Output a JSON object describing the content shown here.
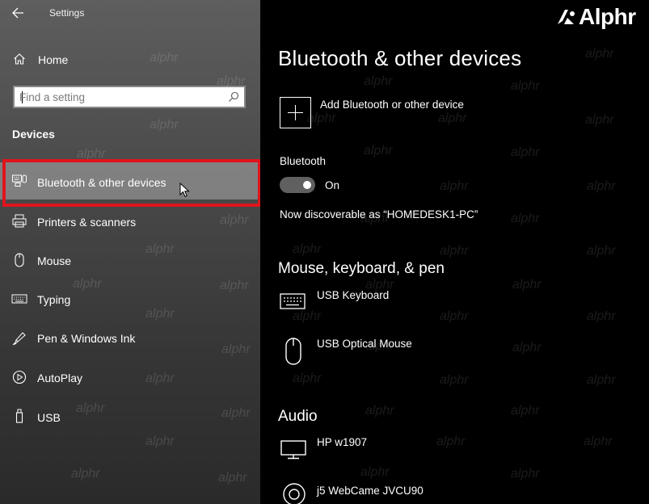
{
  "window": {
    "title": "Settings"
  },
  "sidebar": {
    "home_label": "Home",
    "search_placeholder": "Find a setting",
    "section_title": "Devices",
    "items": [
      {
        "label": "Bluetooth & other devices",
        "icon": "bluetooth-devices-icon",
        "selected": true
      },
      {
        "label": "Printers & scanners",
        "icon": "printer-icon",
        "selected": false
      },
      {
        "label": "Mouse",
        "icon": "mouse-icon",
        "selected": false
      },
      {
        "label": "Typing",
        "icon": "keyboard-icon",
        "selected": false
      },
      {
        "label": "Pen & Windows Ink",
        "icon": "pen-icon",
        "selected": false
      },
      {
        "label": "AutoPlay",
        "icon": "autoplay-icon",
        "selected": false
      },
      {
        "label": "USB",
        "icon": "usb-icon",
        "selected": false
      }
    ]
  },
  "main": {
    "title": "Bluetooth & other devices",
    "add_device_label": "Add Bluetooth or other device",
    "bluetooth": {
      "label": "Bluetooth",
      "state": "On",
      "discoverable_text": "Now discoverable as “HOMEDESK1-PC”"
    },
    "groups": [
      {
        "title": "Mouse, keyboard, & pen",
        "devices": [
          {
            "label": "USB Keyboard",
            "icon": "keyboard-icon"
          },
          {
            "label": "USB Optical Mouse",
            "icon": "mouse-icon"
          }
        ]
      },
      {
        "title": "Audio",
        "devices": [
          {
            "label": "HP w1907",
            "icon": "monitor-icon"
          },
          {
            "label": "j5 WebCame JVCU90",
            "icon": "webcam-icon"
          }
        ]
      }
    ]
  },
  "branding": {
    "logo_text": "Alphr",
    "watermark_text": "alphr"
  },
  "colors": {
    "highlight_border": "#e0141c",
    "selected_background": "#8a8a8a",
    "main_background": "#000000"
  }
}
